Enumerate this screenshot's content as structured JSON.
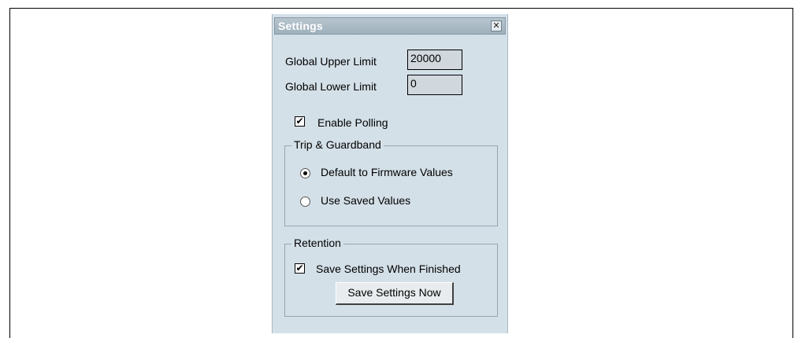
{
  "dialog": {
    "title": "Settings",
    "close_symbol": "✕"
  },
  "fields": {
    "upper_label": "Global Upper Limit",
    "upper_value": "20000",
    "lower_label": "Global Lower Limit",
    "lower_value": "0"
  },
  "polling": {
    "label": "Enable Polling",
    "checked": true,
    "check_mark": "✔"
  },
  "trip_guardband": {
    "legend": "Trip & Guardband",
    "options": [
      {
        "label": "Default to Firmware Values",
        "selected": true
      },
      {
        "label": "Use Saved Values",
        "selected": false
      }
    ]
  },
  "retention": {
    "legend": "Retention",
    "save_when_finished_label": "Save Settings When Finished",
    "save_when_finished_checked": true,
    "check_mark": "✔",
    "save_now_label": "Save Settings Now"
  }
}
